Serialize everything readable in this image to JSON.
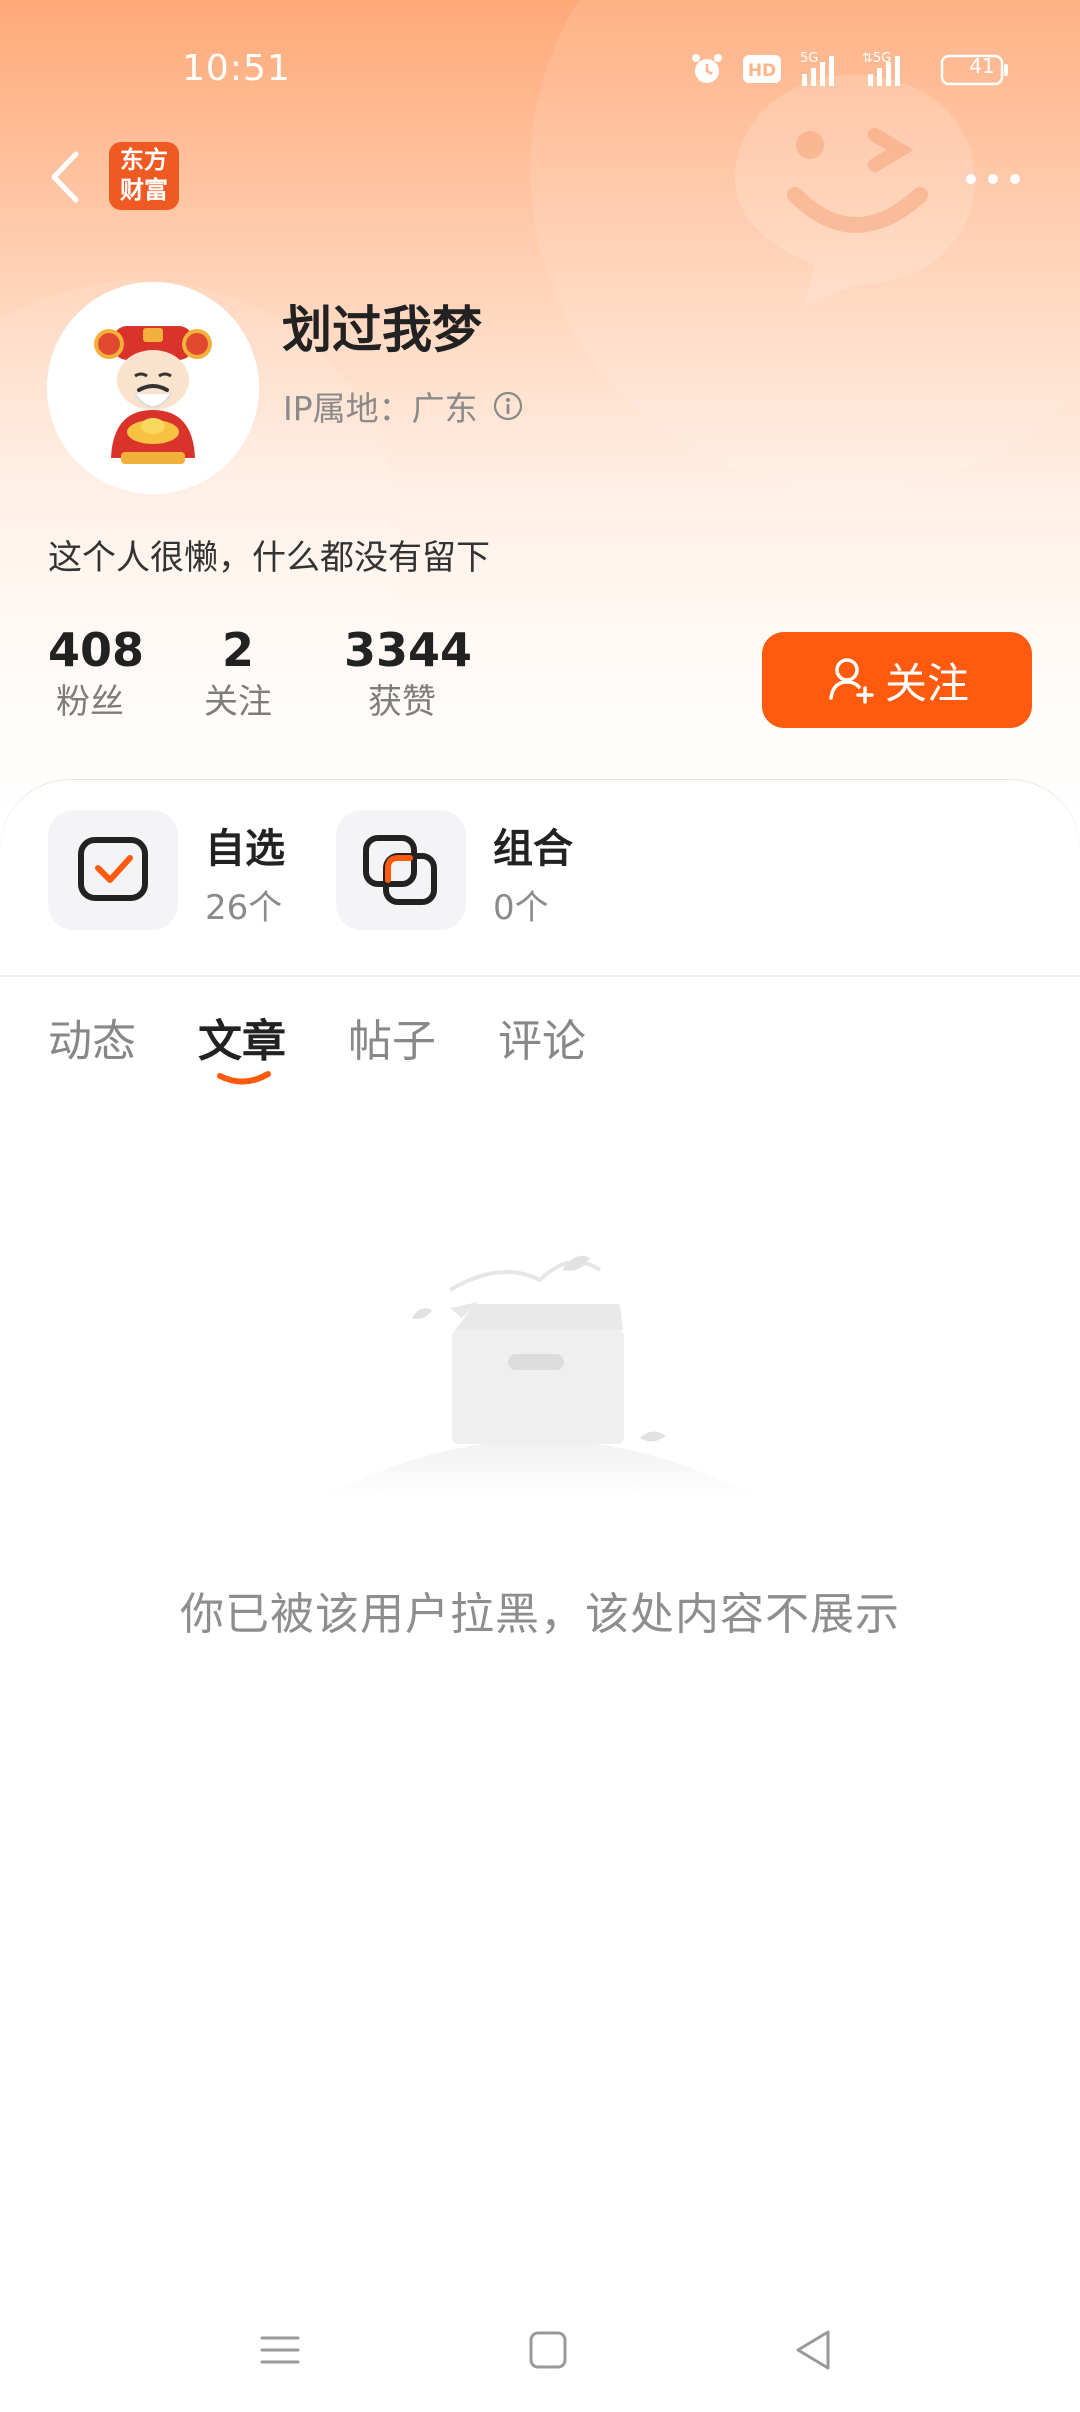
{
  "status_bar": {
    "time": "10:51",
    "battery": "41"
  },
  "header": {
    "app_logo": "东方财富"
  },
  "profile": {
    "name": "划过我梦",
    "ip_label": "IP属地：广东",
    "bio": "这个人很懒，什么都没有留下",
    "stats": [
      {
        "value": "408",
        "label": "粉丝"
      },
      {
        "value": "2",
        "label": "关注"
      },
      {
        "value": "3344",
        "label": "获赞"
      }
    ],
    "follow_label": "关注"
  },
  "shortcuts": [
    {
      "title": "自选",
      "count": "26个",
      "icon": "checkbox-icon"
    },
    {
      "title": "组合",
      "count": "0个",
      "icon": "layers-icon"
    }
  ],
  "tabs": [
    {
      "label": "动态",
      "active": false
    },
    {
      "label": "文章",
      "active": true
    },
    {
      "label": "帖子",
      "active": false
    },
    {
      "label": "评论",
      "active": false
    }
  ],
  "empty_state": {
    "message": "你已被该用户拉黑，该处内容不展示"
  },
  "colors": {
    "accent": "#ff5a0e",
    "brand": "#ef5a22"
  }
}
